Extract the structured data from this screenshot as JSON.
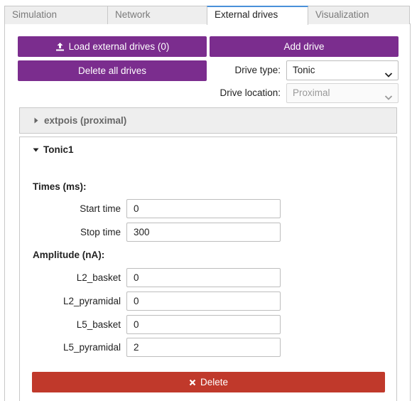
{
  "tabs": [
    {
      "label": "Simulation"
    },
    {
      "label": "Network"
    },
    {
      "label": "External drives"
    },
    {
      "label": "Visualization"
    }
  ],
  "toolbar": {
    "load_label": "Load external drives (0)",
    "add_label": "Add drive",
    "delete_all_label": "Delete all drives"
  },
  "drive_type": {
    "label": "Drive type:",
    "value": "Tonic"
  },
  "drive_location": {
    "label": "Drive location:",
    "value": "Proximal"
  },
  "drives": {
    "collapsed_title": "extpois (proximal)",
    "open_title": "Tonic1"
  },
  "times": {
    "title": "Times (ms):",
    "start_label": "Start time",
    "start_value": "0",
    "stop_label": "Stop time",
    "stop_value": "300"
  },
  "amplitude": {
    "title": "Amplitude (nA):",
    "fields": [
      {
        "label": "L2_basket",
        "value": "0"
      },
      {
        "label": "L2_pyramidal",
        "value": "0"
      },
      {
        "label": "L5_basket",
        "value": "0"
      },
      {
        "label": "L5_pyramidal",
        "value": "2"
      }
    ]
  },
  "delete_label": "Delete",
  "colors": {
    "accent_purple": "#7b2d8e",
    "delete_red": "#c0392b",
    "active_tab_border": "#4a90d9"
  }
}
